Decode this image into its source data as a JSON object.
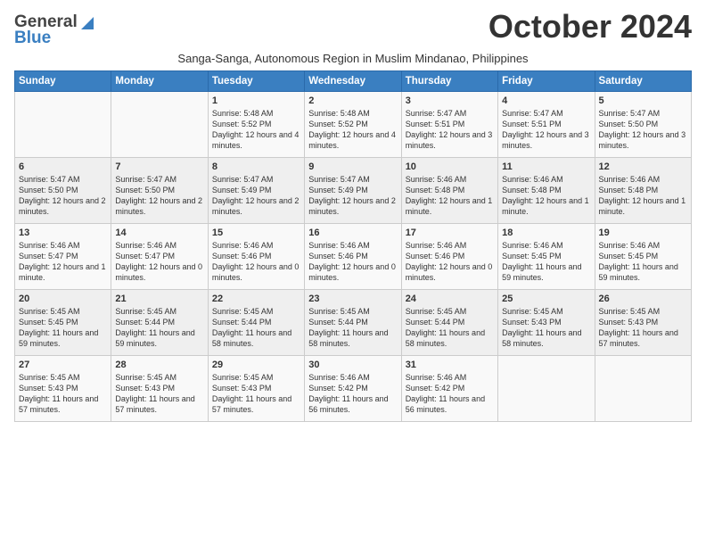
{
  "header": {
    "logo_general": "General",
    "logo_blue": "Blue",
    "month_title": "October 2024",
    "subtitle": "Sanga-Sanga, Autonomous Region in Muslim Mindanao, Philippines"
  },
  "weekdays": [
    "Sunday",
    "Monday",
    "Tuesday",
    "Wednesday",
    "Thursday",
    "Friday",
    "Saturday"
  ],
  "weeks": [
    [
      {
        "day": "",
        "sunrise": "",
        "sunset": "",
        "daylight": ""
      },
      {
        "day": "",
        "sunrise": "",
        "sunset": "",
        "daylight": ""
      },
      {
        "day": "1",
        "sunrise": "Sunrise: 5:48 AM",
        "sunset": "Sunset: 5:52 PM",
        "daylight": "Daylight: 12 hours and 4 minutes."
      },
      {
        "day": "2",
        "sunrise": "Sunrise: 5:48 AM",
        "sunset": "Sunset: 5:52 PM",
        "daylight": "Daylight: 12 hours and 4 minutes."
      },
      {
        "day": "3",
        "sunrise": "Sunrise: 5:47 AM",
        "sunset": "Sunset: 5:51 PM",
        "daylight": "Daylight: 12 hours and 3 minutes."
      },
      {
        "day": "4",
        "sunrise": "Sunrise: 5:47 AM",
        "sunset": "Sunset: 5:51 PM",
        "daylight": "Daylight: 12 hours and 3 minutes."
      },
      {
        "day": "5",
        "sunrise": "Sunrise: 5:47 AM",
        "sunset": "Sunset: 5:50 PM",
        "daylight": "Daylight: 12 hours and 3 minutes."
      }
    ],
    [
      {
        "day": "6",
        "sunrise": "Sunrise: 5:47 AM",
        "sunset": "Sunset: 5:50 PM",
        "daylight": "Daylight: 12 hours and 2 minutes."
      },
      {
        "day": "7",
        "sunrise": "Sunrise: 5:47 AM",
        "sunset": "Sunset: 5:50 PM",
        "daylight": "Daylight: 12 hours and 2 minutes."
      },
      {
        "day": "8",
        "sunrise": "Sunrise: 5:47 AM",
        "sunset": "Sunset: 5:49 PM",
        "daylight": "Daylight: 12 hours and 2 minutes."
      },
      {
        "day": "9",
        "sunrise": "Sunrise: 5:47 AM",
        "sunset": "Sunset: 5:49 PM",
        "daylight": "Daylight: 12 hours and 2 minutes."
      },
      {
        "day": "10",
        "sunrise": "Sunrise: 5:46 AM",
        "sunset": "Sunset: 5:48 PM",
        "daylight": "Daylight: 12 hours and 1 minute."
      },
      {
        "day": "11",
        "sunrise": "Sunrise: 5:46 AM",
        "sunset": "Sunset: 5:48 PM",
        "daylight": "Daylight: 12 hours and 1 minute."
      },
      {
        "day": "12",
        "sunrise": "Sunrise: 5:46 AM",
        "sunset": "Sunset: 5:48 PM",
        "daylight": "Daylight: 12 hours and 1 minute."
      }
    ],
    [
      {
        "day": "13",
        "sunrise": "Sunrise: 5:46 AM",
        "sunset": "Sunset: 5:47 PM",
        "daylight": "Daylight: 12 hours and 1 minute."
      },
      {
        "day": "14",
        "sunrise": "Sunrise: 5:46 AM",
        "sunset": "Sunset: 5:47 PM",
        "daylight": "Daylight: 12 hours and 0 minutes."
      },
      {
        "day": "15",
        "sunrise": "Sunrise: 5:46 AM",
        "sunset": "Sunset: 5:46 PM",
        "daylight": "Daylight: 12 hours and 0 minutes."
      },
      {
        "day": "16",
        "sunrise": "Sunrise: 5:46 AM",
        "sunset": "Sunset: 5:46 PM",
        "daylight": "Daylight: 12 hours and 0 minutes."
      },
      {
        "day": "17",
        "sunrise": "Sunrise: 5:46 AM",
        "sunset": "Sunset: 5:46 PM",
        "daylight": "Daylight: 12 hours and 0 minutes."
      },
      {
        "day": "18",
        "sunrise": "Sunrise: 5:46 AM",
        "sunset": "Sunset: 5:45 PM",
        "daylight": "Daylight: 11 hours and 59 minutes."
      },
      {
        "day": "19",
        "sunrise": "Sunrise: 5:46 AM",
        "sunset": "Sunset: 5:45 PM",
        "daylight": "Daylight: 11 hours and 59 minutes."
      }
    ],
    [
      {
        "day": "20",
        "sunrise": "Sunrise: 5:45 AM",
        "sunset": "Sunset: 5:45 PM",
        "daylight": "Daylight: 11 hours and 59 minutes."
      },
      {
        "day": "21",
        "sunrise": "Sunrise: 5:45 AM",
        "sunset": "Sunset: 5:44 PM",
        "daylight": "Daylight: 11 hours and 59 minutes."
      },
      {
        "day": "22",
        "sunrise": "Sunrise: 5:45 AM",
        "sunset": "Sunset: 5:44 PM",
        "daylight": "Daylight: 11 hours and 58 minutes."
      },
      {
        "day": "23",
        "sunrise": "Sunrise: 5:45 AM",
        "sunset": "Sunset: 5:44 PM",
        "daylight": "Daylight: 11 hours and 58 minutes."
      },
      {
        "day": "24",
        "sunrise": "Sunrise: 5:45 AM",
        "sunset": "Sunset: 5:44 PM",
        "daylight": "Daylight: 11 hours and 58 minutes."
      },
      {
        "day": "25",
        "sunrise": "Sunrise: 5:45 AM",
        "sunset": "Sunset: 5:43 PM",
        "daylight": "Daylight: 11 hours and 58 minutes."
      },
      {
        "day": "26",
        "sunrise": "Sunrise: 5:45 AM",
        "sunset": "Sunset: 5:43 PM",
        "daylight": "Daylight: 11 hours and 57 minutes."
      }
    ],
    [
      {
        "day": "27",
        "sunrise": "Sunrise: 5:45 AM",
        "sunset": "Sunset: 5:43 PM",
        "daylight": "Daylight: 11 hours and 57 minutes."
      },
      {
        "day": "28",
        "sunrise": "Sunrise: 5:45 AM",
        "sunset": "Sunset: 5:43 PM",
        "daylight": "Daylight: 11 hours and 57 minutes."
      },
      {
        "day": "29",
        "sunrise": "Sunrise: 5:45 AM",
        "sunset": "Sunset: 5:43 PM",
        "daylight": "Daylight: 11 hours and 57 minutes."
      },
      {
        "day": "30",
        "sunrise": "Sunrise: 5:46 AM",
        "sunset": "Sunset: 5:42 PM",
        "daylight": "Daylight: 11 hours and 56 minutes."
      },
      {
        "day": "31",
        "sunrise": "Sunrise: 5:46 AM",
        "sunset": "Sunset: 5:42 PM",
        "daylight": "Daylight: 11 hours and 56 minutes."
      },
      {
        "day": "",
        "sunrise": "",
        "sunset": "",
        "daylight": ""
      },
      {
        "day": "",
        "sunrise": "",
        "sunset": "",
        "daylight": ""
      }
    ]
  ]
}
